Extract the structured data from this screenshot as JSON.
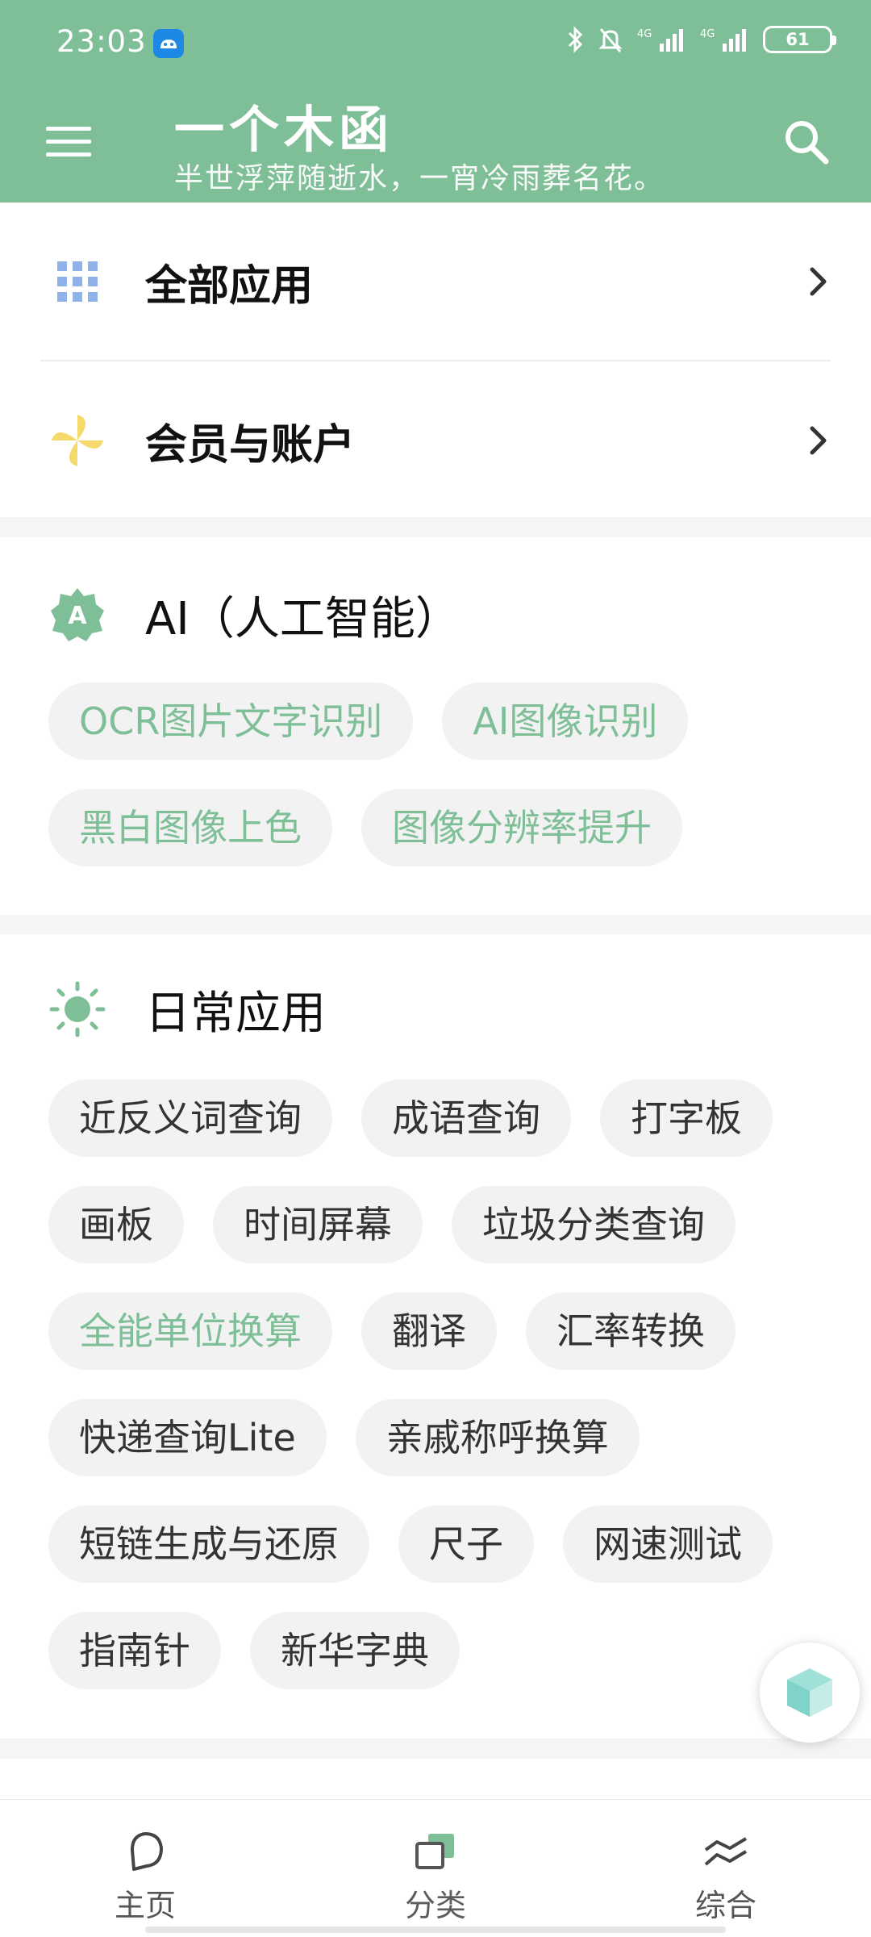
{
  "status": {
    "time": "23:03",
    "battery": "61"
  },
  "header": {
    "title": "一个木函",
    "subtitle": "半世浮萍随逝水，一宵冷雨葬名花。"
  },
  "menu": {
    "all_apps": "全部应用",
    "membership": "会员与账户"
  },
  "ai_section": {
    "title": "AI（人工智能）",
    "chips": [
      "OCR图片文字识别",
      "AI图像识别",
      "黑白图像上色",
      "图像分辨率提升"
    ]
  },
  "daily_section": {
    "title": "日常应用",
    "chips": [
      "近反义词查询",
      "成语查询",
      "打字板",
      "画板",
      "时间屏幕",
      "垃圾分类查询",
      "全能单位换算",
      "翻译",
      "汇率转换",
      "快递查询Lite",
      "亲戚称呼换算",
      "短链生成与还原",
      "尺子",
      "网速测试",
      "指南针",
      "新华字典"
    ]
  },
  "bottom_nav": {
    "home": "主页",
    "category": "分类",
    "overview": "综合"
  },
  "colors": {
    "primary": "#7fbf98",
    "chip_bg": "#f2f2f2"
  }
}
